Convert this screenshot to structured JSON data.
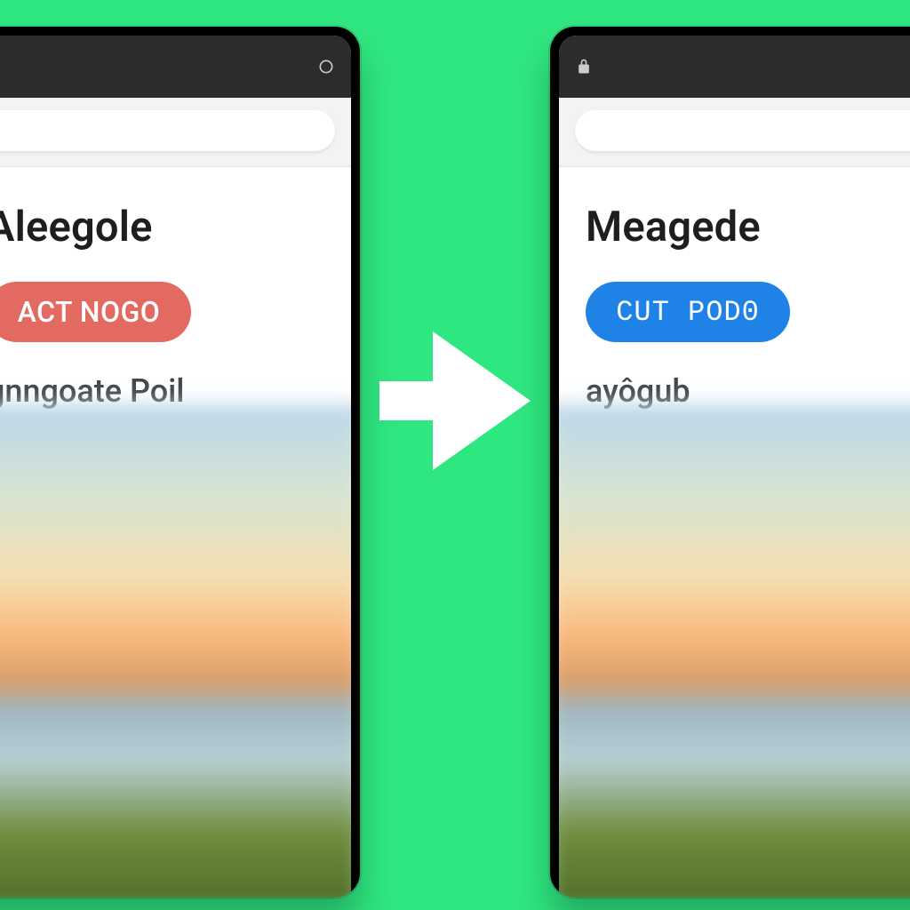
{
  "colors": {
    "bg_green": "#2fe780",
    "btn_red": "#e36a60",
    "btn_blue": "#1e82e6"
  },
  "left": {
    "status_left": "",
    "status_right": "",
    "search_placeholder": "",
    "title": "Aleegole",
    "button_label": "ACT NOGO",
    "subtitle": "gnngoate Poil"
  },
  "right": {
    "status_left": "",
    "status_right": "",
    "search_placeholder": "",
    "title": "Meagede",
    "button_label": "CUT POD0",
    "subtitle": "ayôgub"
  }
}
